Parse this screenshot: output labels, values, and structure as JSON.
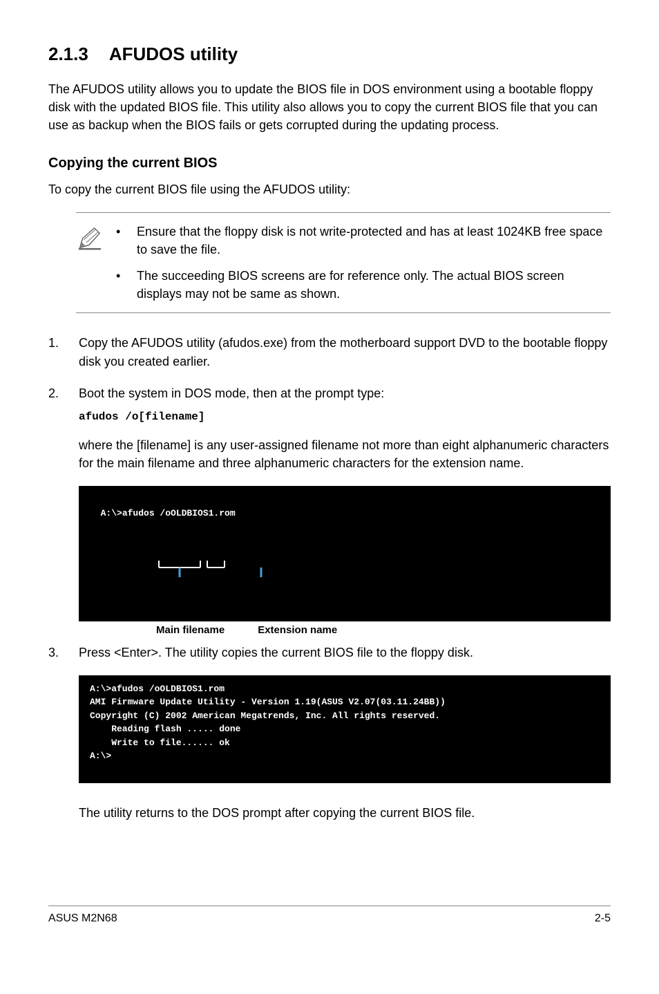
{
  "section_number": "2.1.3",
  "section_title": "AFUDOS utility",
  "intro_para": "The AFUDOS utility allows you to update the BIOS file in DOS environment using a bootable floppy disk with the updated BIOS file. This utility also allows you to copy the current BIOS file that you can use as backup when the BIOS fails or gets corrupted during the updating process.",
  "sub_heading": "Copying the current BIOS",
  "sub_intro": "To copy the current BIOS file using the AFUDOS utility:",
  "notes": [
    "Ensure that the floppy disk is not write-protected and has at least 1024KB free space to save the file.",
    "The succeeding BIOS screens are for reference only. The actual BIOS screen displays may not be same as shown."
  ],
  "steps": {
    "s1": {
      "num": "1.",
      "text": "Copy the AFUDOS utility (afudos.exe) from the motherboard support DVD to the bootable floppy disk you created earlier."
    },
    "s2": {
      "num": "2.",
      "text": "Boot the system in DOS mode, then at the prompt type:",
      "cmd": "afudos /o[filename]",
      "after": "where the [filename] is any user-assigned filename not more than eight alphanumeric characters  for the main filename and three alphanumeric characters for the extension name."
    },
    "s3": {
      "num": "3.",
      "text": "Press <Enter>. The utility copies the current BIOS file to the floppy disk."
    }
  },
  "terminal1_line": "A:\\>afudos /oOLDBIOS1.rom",
  "label_main": "Main filename",
  "label_ext": "Extension name",
  "terminal2": "A:\\>afudos /oOLDBIOS1.rom\nAMI Firmware Update Utility - Version 1.19(ASUS V2.07(03.11.24BB))\nCopyright (C) 2002 American Megatrends, Inc. All rights reserved.\n    Reading flash ..... done\n    Write to file...... ok\nA:\\>\n ",
  "closing": "The utility returns to the DOS prompt after copying the current BIOS file.",
  "footer_left": "ASUS M2N68",
  "footer_right": "2-5"
}
